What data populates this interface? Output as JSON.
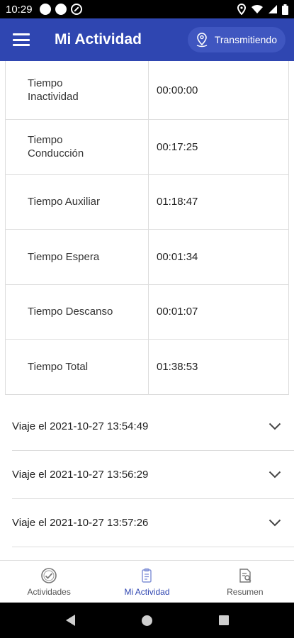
{
  "status_bar": {
    "time": "10:29"
  },
  "header": {
    "title": "Mi Actividad",
    "transmit_label": "Transmitiendo"
  },
  "activity_table": [
    {
      "label": "Tiempo Inactividad",
      "value": "00:00:00"
    },
    {
      "label": "Tiempo Conducción",
      "value": "00:17:25"
    },
    {
      "label": "Tiempo Auxiliar",
      "value": "01:18:47"
    },
    {
      "label": "Tiempo Espera",
      "value": "00:01:34"
    },
    {
      "label": "Tiempo Descanso",
      "value": "00:01:07"
    },
    {
      "label": "Tiempo Total",
      "value": "01:38:53"
    }
  ],
  "trips": [
    {
      "label": "Viaje el 2021-10-27 13:54:49"
    },
    {
      "label": "Viaje el 2021-10-27 13:56:29"
    },
    {
      "label": "Viaje el 2021-10-27 13:57:26"
    }
  ],
  "bottom_nav": [
    {
      "label": "Actividades",
      "icon": "check-circle-icon",
      "active": false
    },
    {
      "label": "Mi Actividad",
      "icon": "clipboard-icon",
      "active": true
    },
    {
      "label": "Resumen",
      "icon": "document-search-icon",
      "active": false
    }
  ],
  "colors": {
    "primary": "#2f46b1",
    "active_nav": "#2f46b1",
    "divider": "#dddddd"
  }
}
